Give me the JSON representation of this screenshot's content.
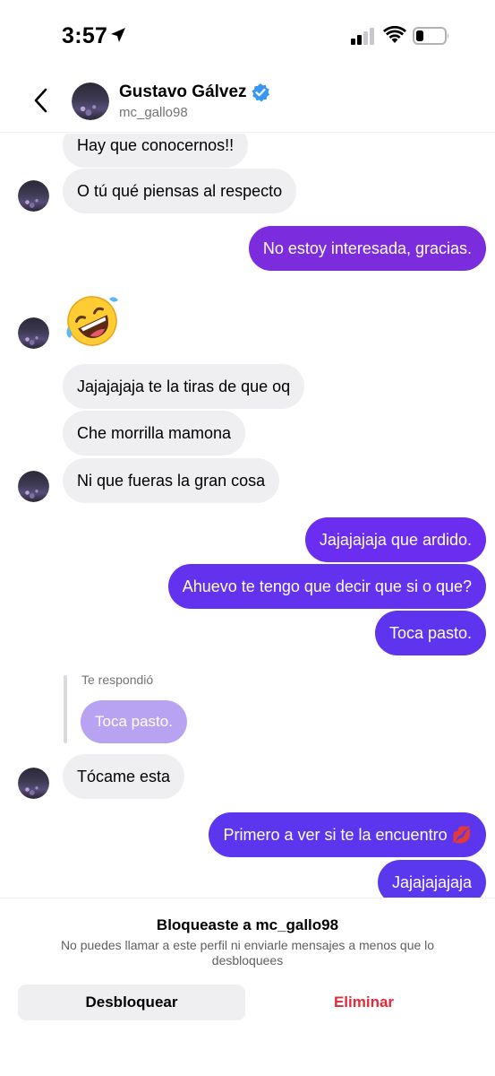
{
  "status_bar": {
    "time": "3:57"
  },
  "header": {
    "name": "Gustavo Gálvez",
    "handle": "mc_gallo98"
  },
  "messages": [
    {
      "side": "in",
      "text": "Hay que conocernos!!"
    },
    {
      "side": "in",
      "text": "O tú qué piensas al respecto"
    },
    {
      "side": "out",
      "text": "No estoy interesada, gracias."
    },
    {
      "side": "in",
      "emoji": "🤣"
    },
    {
      "side": "in",
      "text": "Jajajajaja te la tiras de que oq"
    },
    {
      "side": "in",
      "text": "Che morrilla mamona"
    },
    {
      "side": "in",
      "text": "Ni que fueras la gran cosa"
    },
    {
      "side": "out",
      "text": "Jajajajaja que ardido."
    },
    {
      "side": "out",
      "text": "Ahuevo te tengo que decir que si o que?"
    },
    {
      "side": "out",
      "text": "Toca pasto."
    },
    {
      "side": "in",
      "text": "Tócame esta"
    },
    {
      "side": "out",
      "text": "Primero a ver si te la encuentro 💋"
    },
    {
      "side": "out",
      "text": "Jajajajajaja"
    }
  ],
  "reply": {
    "label": "Te respondió",
    "quoted": "Toca pasto."
  },
  "footer": {
    "title": "Bloqueaste a mc_gallo98",
    "description": "No puedes llamar a este perfil ni enviarle mensajes a menos que lo desbloquees",
    "unblock_label": "Desbloquear",
    "delete_label": "Eliminar"
  },
  "colors": {
    "outgoing_1": "#7b2cdc",
    "outgoing_2": "#6b2ef0",
    "outgoing_3": "#5b36ee",
    "incoming": "#efeff1",
    "danger": "#e32a3a",
    "verified": "#3897f0"
  }
}
